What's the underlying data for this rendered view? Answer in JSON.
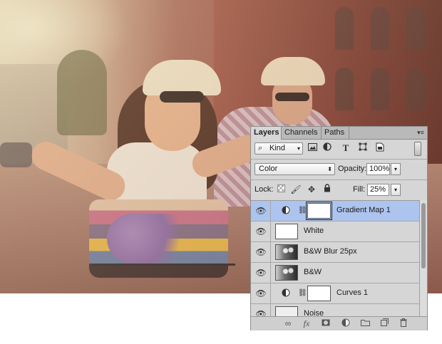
{
  "panel": {
    "tabs": [
      {
        "label": "Layers",
        "active": true
      },
      {
        "label": "Channels",
        "active": false
      },
      {
        "label": "Paths",
        "active": false
      }
    ],
    "menu_icon": "panel-menu-icon",
    "filter": {
      "kind_label": "Kind",
      "icons": [
        "image-filter-icon",
        "adjustment-filter-icon",
        "type-filter-icon",
        "shape-filter-icon",
        "smart-object-filter-icon"
      ]
    },
    "blend_mode": "Color",
    "opacity_label": "Opacity:",
    "opacity_value": "100%",
    "lock_label": "Lock:",
    "fill_label": "Fill:",
    "fill_value": "25%",
    "layers": [
      {
        "name": "Gradient Map 1",
        "type": "adjustment",
        "selected": true,
        "visible": true
      },
      {
        "name": "White",
        "type": "pixel",
        "selected": false,
        "visible": true
      },
      {
        "name": "B&W Blur 25px",
        "type": "pixel",
        "selected": false,
        "visible": true
      },
      {
        "name": "B&W",
        "type": "pixel",
        "selected": false,
        "visible": true
      },
      {
        "name": "Curves 1",
        "type": "adjustment",
        "selected": false,
        "visible": true
      },
      {
        "name": "Noise",
        "type": "pixel",
        "selected": false,
        "visible": true
      }
    ],
    "bottom_icons": [
      "link-layers-icon",
      "fx-icon",
      "add-mask-icon",
      "new-adjustment-icon",
      "new-group-icon",
      "new-layer-icon",
      "trash-icon"
    ]
  },
  "colors": {
    "selected_layer": "#adc4ee",
    "panel_bg": "#d6d6d6"
  }
}
